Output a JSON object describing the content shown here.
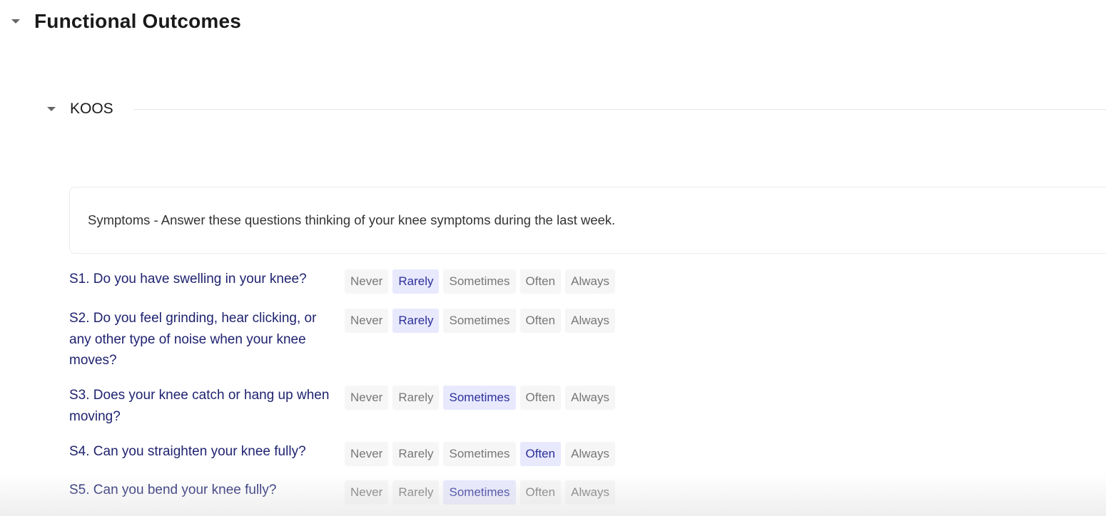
{
  "section": {
    "title": "Functional Outcomes"
  },
  "subsection": {
    "title": "KOOS"
  },
  "instructions": "Symptoms - Answer these questions thinking of your knee symptoms during the last week.",
  "options": [
    "Never",
    "Rarely",
    "Sometimes",
    "Often",
    "Always"
  ],
  "questions": [
    {
      "text": "S1. Do you have swelling in your knee?",
      "selected": "Rarely"
    },
    {
      "text": "S2. Do you feel grinding, hear clicking, or any other type of noise when your knee moves?",
      "selected": "Rarely"
    },
    {
      "text": "S3. Does your knee catch or hang up when moving?",
      "selected": "Sometimes"
    },
    {
      "text": "S4. Can you straighten your knee fully?",
      "selected": "Often"
    },
    {
      "text": "S5. Can you bend your knee fully?",
      "selected": "Sometimes"
    }
  ],
  "colors": {
    "question_text": "#1f2370",
    "selected_bg": "#e8e9fd",
    "selected_text": "#2c2f9a",
    "option_bg": "#f6f6f6",
    "option_text": "#777777"
  }
}
